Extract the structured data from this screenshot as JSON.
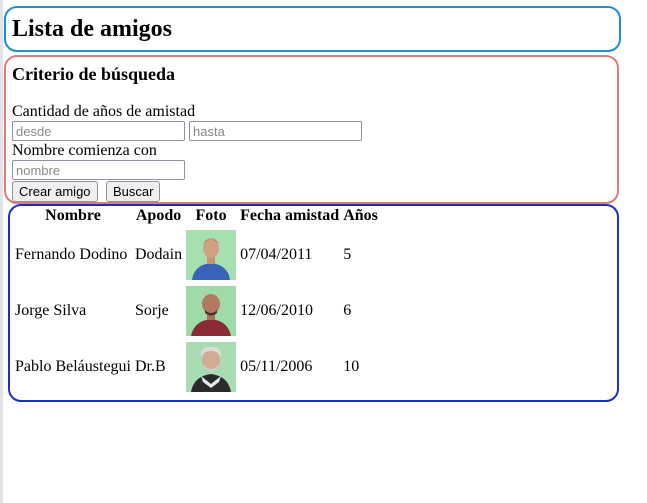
{
  "page": {
    "title": "Lista de amigos"
  },
  "search": {
    "heading": "Criterio de búsqueda",
    "years_label": "Cantidad de años de amistad",
    "from_placeholder": "desde",
    "to_placeholder": "hasta",
    "name_label": "Nombre comienza con",
    "name_placeholder": "nombre",
    "create_label": "Crear amigo",
    "search_label": "Buscar"
  },
  "table": {
    "headers": [
      "Nombre",
      "Apodo",
      "Foto",
      "Fecha amistad",
      "Años"
    ],
    "rows": [
      {
        "nombre": "Fernando Dodino",
        "apodo": "Dodain",
        "foto": "photo-fernando",
        "fecha": "07/04/2011",
        "anios": "5"
      },
      {
        "nombre": "Jorge Silva",
        "apodo": "Sorje",
        "foto": "photo-jorge",
        "fecha": "12/06/2010",
        "anios": "6"
      },
      {
        "nombre": "Pablo Beláustegui",
        "apodo": "Dr.B",
        "foto": "photo-pablo",
        "fecha": "05/11/2006",
        "anios": "10"
      }
    ]
  },
  "colors": {
    "title_border": "#1c8fd6",
    "search_border": "#e07b7b",
    "table_border": "#1a2fc6"
  }
}
